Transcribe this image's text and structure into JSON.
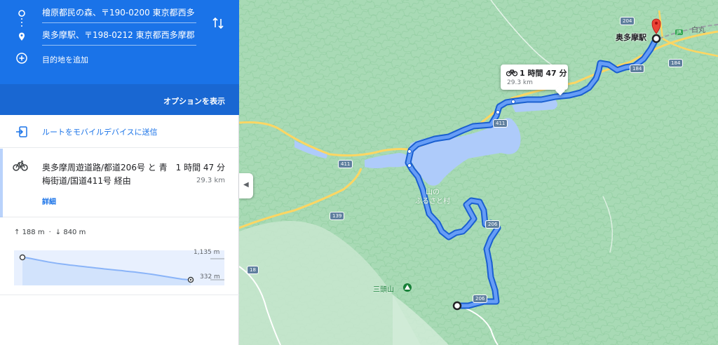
{
  "directions": {
    "origin": "檜原都民の森、〒190-0200 東京都西多",
    "destination": "奥多摩駅、〒198-0212 東京都西多摩郡",
    "add_destination": "目的地を追加",
    "options": "オプションを表示",
    "origin_icon": "origin-circle-icon",
    "destination_icon": "destination-pin-icon",
    "swap_icon": "swap-arrows-icon"
  },
  "send_to_mobile": {
    "label": "ルートをモバイルデバイスに送信",
    "icon": "send-to-phone-icon"
  },
  "route": {
    "mode_icon": "bicycle-icon",
    "description": "奥多摩周遊道路/都道206号 と 青梅街道/国道411号 経由",
    "time": "1 時間 47 分",
    "distance": "29.3 km",
    "details": "詳細"
  },
  "elevation": {
    "ascent": "188 m",
    "descent": "840 m",
    "max_label": "1,135 m",
    "min_label": "332 m",
    "profile_m": [
      1135,
      1120,
      1090,
      1060,
      1030,
      1000,
      970,
      945,
      920,
      900,
      880,
      860,
      845,
      825,
      810,
      790,
      775,
      755,
      740,
      720,
      705,
      690,
      675,
      660,
      640,
      625,
      610,
      590,
      570,
      550,
      530,
      505,
      480,
      455,
      430,
      405,
      380,
      355,
      340,
      332
    ]
  },
  "collapse_icon": "chevron-left-icon",
  "map": {
    "route_bubble": {
      "time": "1 時間 47 分",
      "distance": "29.3 km"
    },
    "labels": {
      "okutama_station": "奥多摩駅",
      "village": "山の\nふるさと村",
      "mitousan": "三頭山",
      "shiromaru": "白丸",
      "jr": "JR"
    },
    "road_shields": [
      "204",
      "184",
      "184",
      "411",
      "411",
      "139",
      "206",
      "206",
      "18"
    ],
    "colors": {
      "route": "#4285f4",
      "route_outline": "#1a5fd0",
      "lake": "#aecbfa",
      "forest": "#a8dab5",
      "road": "#fdd663",
      "destination_pin": "#ea4335",
      "panel_blue": "#1a73e8"
    }
  }
}
